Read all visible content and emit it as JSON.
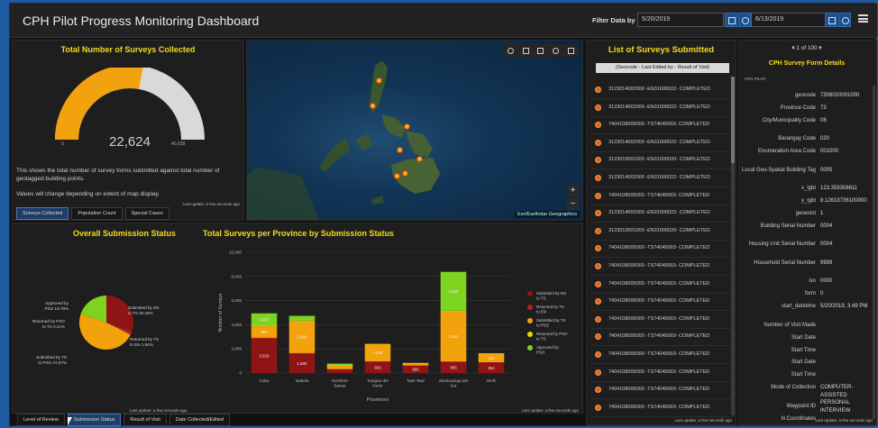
{
  "header": {
    "title": "CPH Pilot Progress Monitoring Dashboard",
    "filter_label": "Filter Data by Date",
    "date_start": "5/20/2019",
    "date_end": "6/13/2019"
  },
  "surveys_panel": {
    "title": "Total Number of Surveys Collected",
    "value": "22,624",
    "min_label": "0",
    "max_label": "40,639",
    "fraction": 0.557,
    "description_1": "This shows the total number of survey forms submitted against total number of geotagged building points.",
    "description_2": "Values will change depending on extent of map display.",
    "last_update": "Last update: a few seconds ago",
    "tabs": [
      "Surveys Collected",
      "Population Count",
      "Special Cases"
    ],
    "active_tab": 0
  },
  "map": {
    "attribution": "Esri/Earthstar Geographics",
    "tools": [
      "search-icon",
      "bookmark-icon",
      "list-icon",
      "layers-icon",
      "grid-icon"
    ]
  },
  "status_panel": {
    "title": "Overall Submission Status",
    "last_update": "Last update: a few seconds ago",
    "tabs": [
      "Level of Review",
      "Submission Status",
      "Result of Visit",
      "Date Collected/Edited"
    ],
    "active_tab": 1
  },
  "province_panel": {
    "title": "Total Surveys per Province by Submission Status",
    "last_update": "Last update: a few seconds ago"
  },
  "chart_data": [
    {
      "type": "pie",
      "title": "Overall Submission Status",
      "slices": [
        {
          "label": "Submitted by EN to TS 30.46%",
          "value": 30.46,
          "color": "#8f1414"
        },
        {
          "label": "Returned by TS to EN 1.94%",
          "value": 1.94,
          "color": "#b22222"
        },
        {
          "label": "Submitted by TS to PSO 47.57%",
          "value": 47.57,
          "color": "#f2a20c"
        },
        {
          "label": "Returned by PSO to TS 0.21%",
          "value": 0.21,
          "color": "#e8d80c"
        },
        {
          "label": "Approved by PSO 19.78%",
          "value": 19.78,
          "color": "#7ed321"
        }
      ]
    },
    {
      "type": "bar",
      "title": "Total Surveys per Province by Submission Status",
      "xlabel": "Provinces",
      "ylabel": "Number of Surveys",
      "ylim": [
        0,
        10000
      ],
      "yticks": [
        "0",
        "2,000",
        "4,000",
        "6,000",
        "8,000",
        "10,000"
      ],
      "categories": [
        "Cebu",
        "Isabela",
        "Northern Samar",
        "Surigao del Norte",
        "Tawi-Tawi",
        "Zamboanga del Sur",
        "NCR"
      ],
      "series": [
        {
          "name": "Submitted by EN to TS",
          "color": "#8f1414",
          "values": [
            2819,
            1600,
            300,
            926,
            595,
            895,
            854
          ],
          "labels": [
            "2,819",
            "1,600",
            "",
            "926",
            "595",
            "895",
            "854"
          ]
        },
        {
          "name": "Returned by TS to EN",
          "color": "#b22222",
          "values": [
            100,
            50,
            20,
            40,
            30,
            60,
            40
          ],
          "labels": [
            "",
            "",
            "",
            "",
            "",
            "",
            ""
          ]
        },
        {
          "name": "Submitted by TS to PSO",
          "color": "#f2a20c",
          "values": [
            950,
            2656,
            300,
            1426,
            200,
            4161,
            720
          ],
          "labels": [
            "950",
            "2,656",
            "",
            "1,426",
            "",
            "4,161",
            "720"
          ]
        },
        {
          "name": "Returned by PSO to TS",
          "color": "#e8d80c",
          "values": [
            50,
            30,
            10,
            20,
            10,
            40,
            20
          ],
          "labels": [
            "",
            "",
            "",
            "",
            "",
            "",
            ""
          ]
        },
        {
          "name": "Approved by PSO",
          "color": "#7ed321",
          "values": [
            1027,
            400,
            150,
            0,
            0,
            3225,
            0
          ],
          "labels": [
            "1,027",
            "",
            "",
            "",
            "",
            "3,225",
            ""
          ]
        }
      ],
      "legend_position": "right"
    }
  ],
  "submitted_list": {
    "title": "List of Surveys Submitted",
    "subtitle": "(Geocode - Last Edited by - Result of Visit)",
    "last_update": "Last update: a few seconds ago",
    "items": [
      "3123014002000 -EN31000022- COMPLETED",
      "3123014002000 -EN31000022- COMPLETED",
      "7404108005000 -TS74040003- COMPLETED",
      "3123014002000 -EN31000022- COMPLETED",
      "3123010001000 -EN31000020- COMPLETED",
      "3123014002000 -EN31000022- COMPLETED",
      "7404108005000 -TS74040003- COMPLETED",
      "3123014002000 -EN31000022- COMPLETED",
      "3123010001000 -EN31000020- COMPLETED",
      "7404108005000 -TS74040003- COMPLETED",
      "7404108005000 -TS74040003- COMPLETED",
      "7404108005000 -TS74040003- COMPLETED",
      "7404108005000 -TS74040003- COMPLETED",
      "7404108005000 -TS74040003- COMPLETED",
      "7404108005000 -TS74040003- COMPLETED",
      "7404108005000 -TS74040003- COMPLETED",
      "7404108005000 -TS74040003- COMPLETED",
      "7404108005000 -TS74040003- COMPLETED",
      "7404108005000 -TS74040003- COMPLETED"
    ]
  },
  "details": {
    "pager": "1 of 100",
    "title": "CPH Survey Form Details",
    "subtitle": "CPH PILOT",
    "last_update": "Last update: a few seconds ago",
    "fields": [
      {
        "key": "geocode",
        "value": "7308020001000"
      },
      {
        "key": "Province Code",
        "value": "73"
      },
      {
        "key": "City/Municipality Code",
        "value": "08"
      },
      {
        "key": "Barangay Code",
        "value": "020"
      },
      {
        "key": "Enumeration Area Code",
        "value": "001000"
      },
      {
        "key": "Local Geo-Spatial Building Tag",
        "value": "0005"
      },
      {
        "key": "x_lgbt",
        "value": "123.359308611"
      },
      {
        "key": "y_lgbt",
        "value": "8.12619736100000"
      },
      {
        "key": "geoexist",
        "value": "1"
      },
      {
        "key": "Building Serial Number",
        "value": "0004"
      },
      {
        "key": "Housing Unit Serial Number",
        "value": "0004"
      },
      {
        "key": "Household Serial Number",
        "value": "9999"
      },
      {
        "key": "isn",
        "value": "0000"
      },
      {
        "key": "form",
        "value": "0"
      },
      {
        "key": "start_datetime",
        "value": "5/20/2019, 3:49 PM"
      },
      {
        "key": "Number of Visit Made",
        "value": ""
      },
      {
        "key": "Start Date",
        "value": ""
      },
      {
        "key": "Start Time",
        "value": ""
      },
      {
        "key": "Start Date",
        "value": ""
      },
      {
        "key": "Start Time",
        "value": ""
      },
      {
        "key": "Mode of Collection",
        "value": "COMPUTER-ASSISTED PERSONAL INTERVIEW"
      },
      {
        "key": "Waypoint ID",
        "value": ""
      },
      {
        "key": "N Coordinates",
        "value": ""
      }
    ]
  }
}
